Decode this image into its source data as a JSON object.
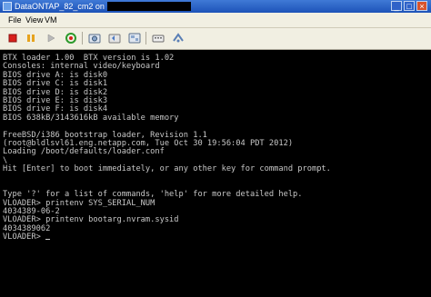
{
  "window": {
    "title": "DataONTAP_82_cm2 on",
    "buttons": {
      "minimize": "_",
      "maximize": "□",
      "close": "×"
    }
  },
  "menu": {
    "items": [
      "File",
      "View",
      "VM"
    ]
  },
  "toolbar": {
    "icons": [
      "stop-icon",
      "pause-icon",
      "play-icon",
      "reset-icon",
      "snapshot-icon",
      "revert-icon",
      "snapshot-manager-icon",
      "ctrl-alt-del-icon",
      "network-icon"
    ]
  },
  "console": {
    "lines": [
      "BTX loader 1.00  BTX version is 1.02",
      "Consoles: internal video/keyboard",
      "BIOS drive A: is disk0",
      "BIOS drive C: is disk1",
      "BIOS drive D: is disk2",
      "BIOS drive E: is disk3",
      "BIOS drive F: is disk4",
      "BIOS 638kB/3143616kB available memory",
      "",
      "FreeBSD/i386 bootstrap loader, Revision 1.1",
      "(root@bldlsvl61.eng.netapp.com, Tue Oct 30 19:56:04 PDT 2012)",
      "Loading /boot/defaults/loader.conf",
      "\\",
      "Hit [Enter] to boot immediately, or any other key for command prompt.",
      "",
      "",
      "Type '?' for a list of commands, 'help' for more detailed help.",
      "VLOADER> printenv SYS_SERIAL_NUM",
      "4034389-06-2",
      "VLOADER> printenv bootarg.nvram.sysid",
      "4034389062",
      "VLOADER> "
    ]
  },
  "colors": {
    "console_bg": "#000000",
    "console_fg": "#c8c8c8",
    "titlebar": "#1d53b8"
  }
}
